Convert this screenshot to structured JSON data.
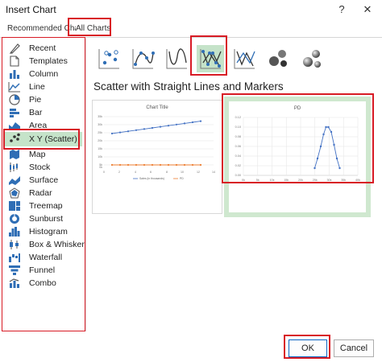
{
  "window": {
    "title": "Insert Chart",
    "help_label": "?",
    "close_label": "✕"
  },
  "tabs": [
    {
      "label": "Recommended Charts"
    },
    {
      "label": "All Charts"
    }
  ],
  "sidebar": {
    "items": [
      {
        "label": "Recent",
        "icon": "recent-icon"
      },
      {
        "label": "Templates",
        "icon": "templates-icon"
      },
      {
        "label": "Column",
        "icon": "column-chart-icon"
      },
      {
        "label": "Line",
        "icon": "line-chart-icon"
      },
      {
        "label": "Pie",
        "icon": "pie-chart-icon"
      },
      {
        "label": "Bar",
        "icon": "bar-chart-icon"
      },
      {
        "label": "Area",
        "icon": "area-chart-icon"
      },
      {
        "label": "X Y (Scatter)",
        "icon": "scatter-chart-icon",
        "selected": true
      },
      {
        "label": "Map",
        "icon": "map-chart-icon"
      },
      {
        "label": "Stock",
        "icon": "stock-chart-icon"
      },
      {
        "label": "Surface",
        "icon": "surface-chart-icon"
      },
      {
        "label": "Radar",
        "icon": "radar-chart-icon"
      },
      {
        "label": "Treemap",
        "icon": "treemap-chart-icon"
      },
      {
        "label": "Sunburst",
        "icon": "sunburst-chart-icon"
      },
      {
        "label": "Histogram",
        "icon": "histogram-chart-icon"
      },
      {
        "label": "Box & Whisker",
        "icon": "box-whisker-chart-icon"
      },
      {
        "label": "Waterfall",
        "icon": "waterfall-chart-icon"
      },
      {
        "label": "Funnel",
        "icon": "funnel-chart-icon"
      },
      {
        "label": "Combo",
        "icon": "combo-chart-icon"
      }
    ]
  },
  "subtypes": [
    {
      "icon": "scatter-markers-icon"
    },
    {
      "icon": "scatter-smooth-lines-markers-icon"
    },
    {
      "icon": "scatter-smooth-lines-icon"
    },
    {
      "icon": "scatter-straight-lines-markers-icon",
      "selected": true
    },
    {
      "icon": "scatter-straight-lines-icon"
    },
    {
      "icon": "bubble-icon"
    },
    {
      "icon": "bubble-3d-icon"
    }
  ],
  "selected_subtype_title": "Scatter with Straight Lines and Markers",
  "previews": {
    "left": {
      "title": "Chart Title",
      "y_ticks": [
        "35k",
        "30k",
        "25k",
        "20k",
        "15k",
        "10k",
        "5k",
        "0k"
      ],
      "x_ticks": [
        "0",
        "2",
        "4",
        "6",
        "8",
        "10",
        "12",
        "14"
      ],
      "legend": [
        "Sales (in thousands)",
        "PD"
      ],
      "colors": {
        "sales": "#4472c4",
        "pd": "#ed7d31"
      }
    },
    "right": {
      "title": "PD",
      "y_ticks": [
        "0.12",
        "0.10",
        "0.08",
        "0.06",
        "0.04",
        "0.02",
        "0.00"
      ],
      "x_ticks": [
        "0k",
        "5k",
        "10k",
        "15k",
        "20k",
        "25k",
        "30k",
        "35k",
        "40k"
      ],
      "color": "#4472c4"
    }
  },
  "footer": {
    "ok_label": "OK",
    "cancel_label": "Cancel"
  },
  "colors": {
    "highlight_red": "#d81b25",
    "selection_green": "#c5e3c9",
    "primary_border": "#0a64c2"
  }
}
